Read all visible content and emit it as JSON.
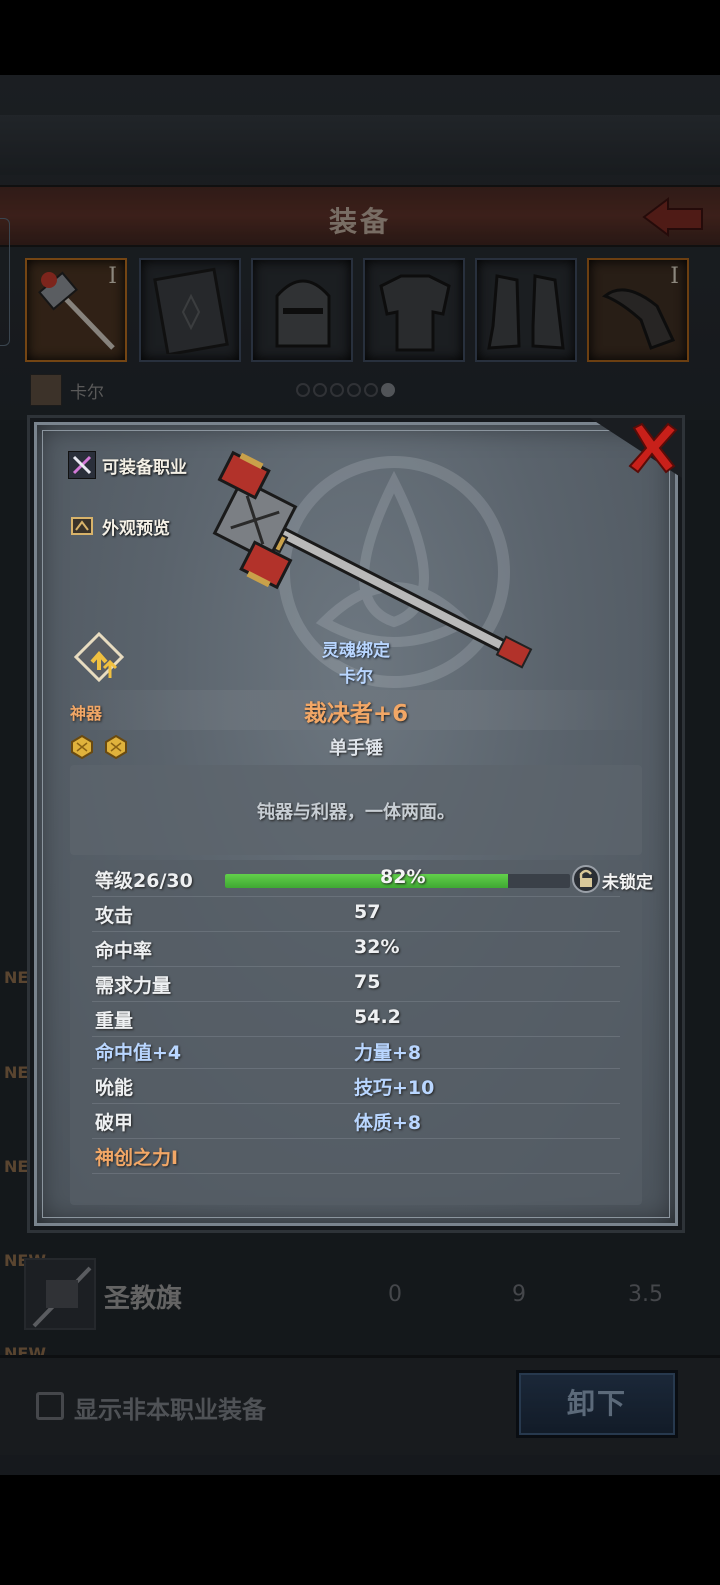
{
  "screen": {
    "title": "装备",
    "character_name": "卡尔",
    "slot_tiers": [
      "I",
      "",
      "",
      "",
      "",
      "I"
    ],
    "background_item": {
      "new_tags": [
        "NEW",
        "NEW",
        "NEW",
        "NEW",
        "NEW"
      ],
      "name": "圣教旗",
      "values": [
        "0",
        "9",
        "3.5"
      ]
    },
    "show_non_class_label": "显示非本职业装备",
    "unequip_label": "卸下"
  },
  "item": {
    "equip_class_label": "可装备职业",
    "preview_label": "外观预览",
    "soul_bound_label": "灵魂绑定",
    "soul_bound_owner": "卡尔",
    "name": "裁决者+6",
    "rarity": "神器",
    "gem_count": 2,
    "type": "单手锤",
    "description": "钝器与利器，一体两面。",
    "level_label": "等级26/30",
    "xp_percent_label": "82%",
    "xp_fraction": 0.82,
    "lock_label": "未锁定",
    "stats": [
      {
        "key": "攻击",
        "value": "57"
      },
      {
        "key": "命中率",
        "value": "32%"
      },
      {
        "key": "需求力量",
        "value": "75"
      },
      {
        "key": "重量",
        "value": "54.2"
      },
      {
        "key": "命中值+4",
        "value": "力量+8"
      },
      {
        "key": "吮能",
        "value": "技巧+10"
      },
      {
        "key": "破甲",
        "value": "体质+8"
      },
      {
        "key": "神创之力I",
        "value": ""
      }
    ]
  },
  "colors": {
    "rarity_orange": "#f2a766",
    "bonus_blue": "#b9d6ff",
    "xp_green": "#4fbf3c",
    "close_red": "#c8201a"
  },
  "icons": [
    "back-arrow-icon",
    "close-x-icon",
    "crossed-weapons-icon",
    "appearance-preview-icon",
    "upgrade-arrow-icon",
    "gem-icon",
    "lock-icon",
    "triquetra-emblem"
  ]
}
